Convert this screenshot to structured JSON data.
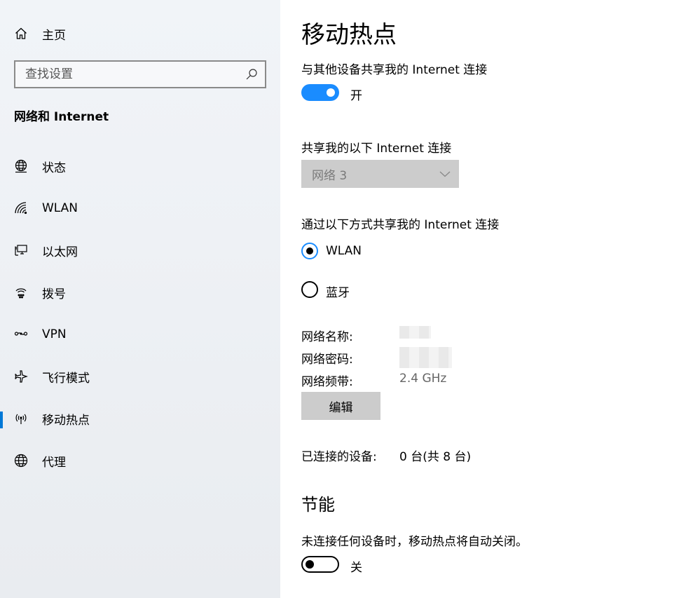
{
  "sidebar": {
    "home_label": "主页",
    "search_placeholder": "查找设置",
    "section_title": "网络和 Internet",
    "items": [
      {
        "label": "状态"
      },
      {
        "label": "WLAN"
      },
      {
        "label": "以太网"
      },
      {
        "label": "拨号"
      },
      {
        "label": "VPN"
      },
      {
        "label": "飞行模式"
      },
      {
        "label": "移动热点",
        "active": true
      },
      {
        "label": "代理"
      }
    ]
  },
  "main": {
    "title": "移动热点",
    "share_label": "与其他设备共享我的 Internet 连接",
    "share_toggle_state": "开",
    "share_from_label": "共享我的以下 Internet 连接",
    "share_from_value": "网络 3",
    "share_over_label": "通过以下方式共享我的 Internet 连接",
    "radio_options": [
      "WLAN",
      "蓝牙"
    ],
    "radio_selected": "WLAN",
    "network_name_label": "网络名称:",
    "network_password_label": "网络密码:",
    "network_band_label": "网络频带:",
    "network_band_value": "2.4 GHz",
    "edit_button": "编辑",
    "connected_label": "已连接的设备:",
    "connected_value": "0 台(共 8 台)",
    "power_heading": "节能",
    "power_desc": "未连接任何设备时，移动热点将自动关闭。",
    "power_toggle_state": "关"
  },
  "colors": {
    "accent": "#0078d7",
    "toggle_on": "#1a8cff",
    "disabled_bg": "#cccccc"
  }
}
